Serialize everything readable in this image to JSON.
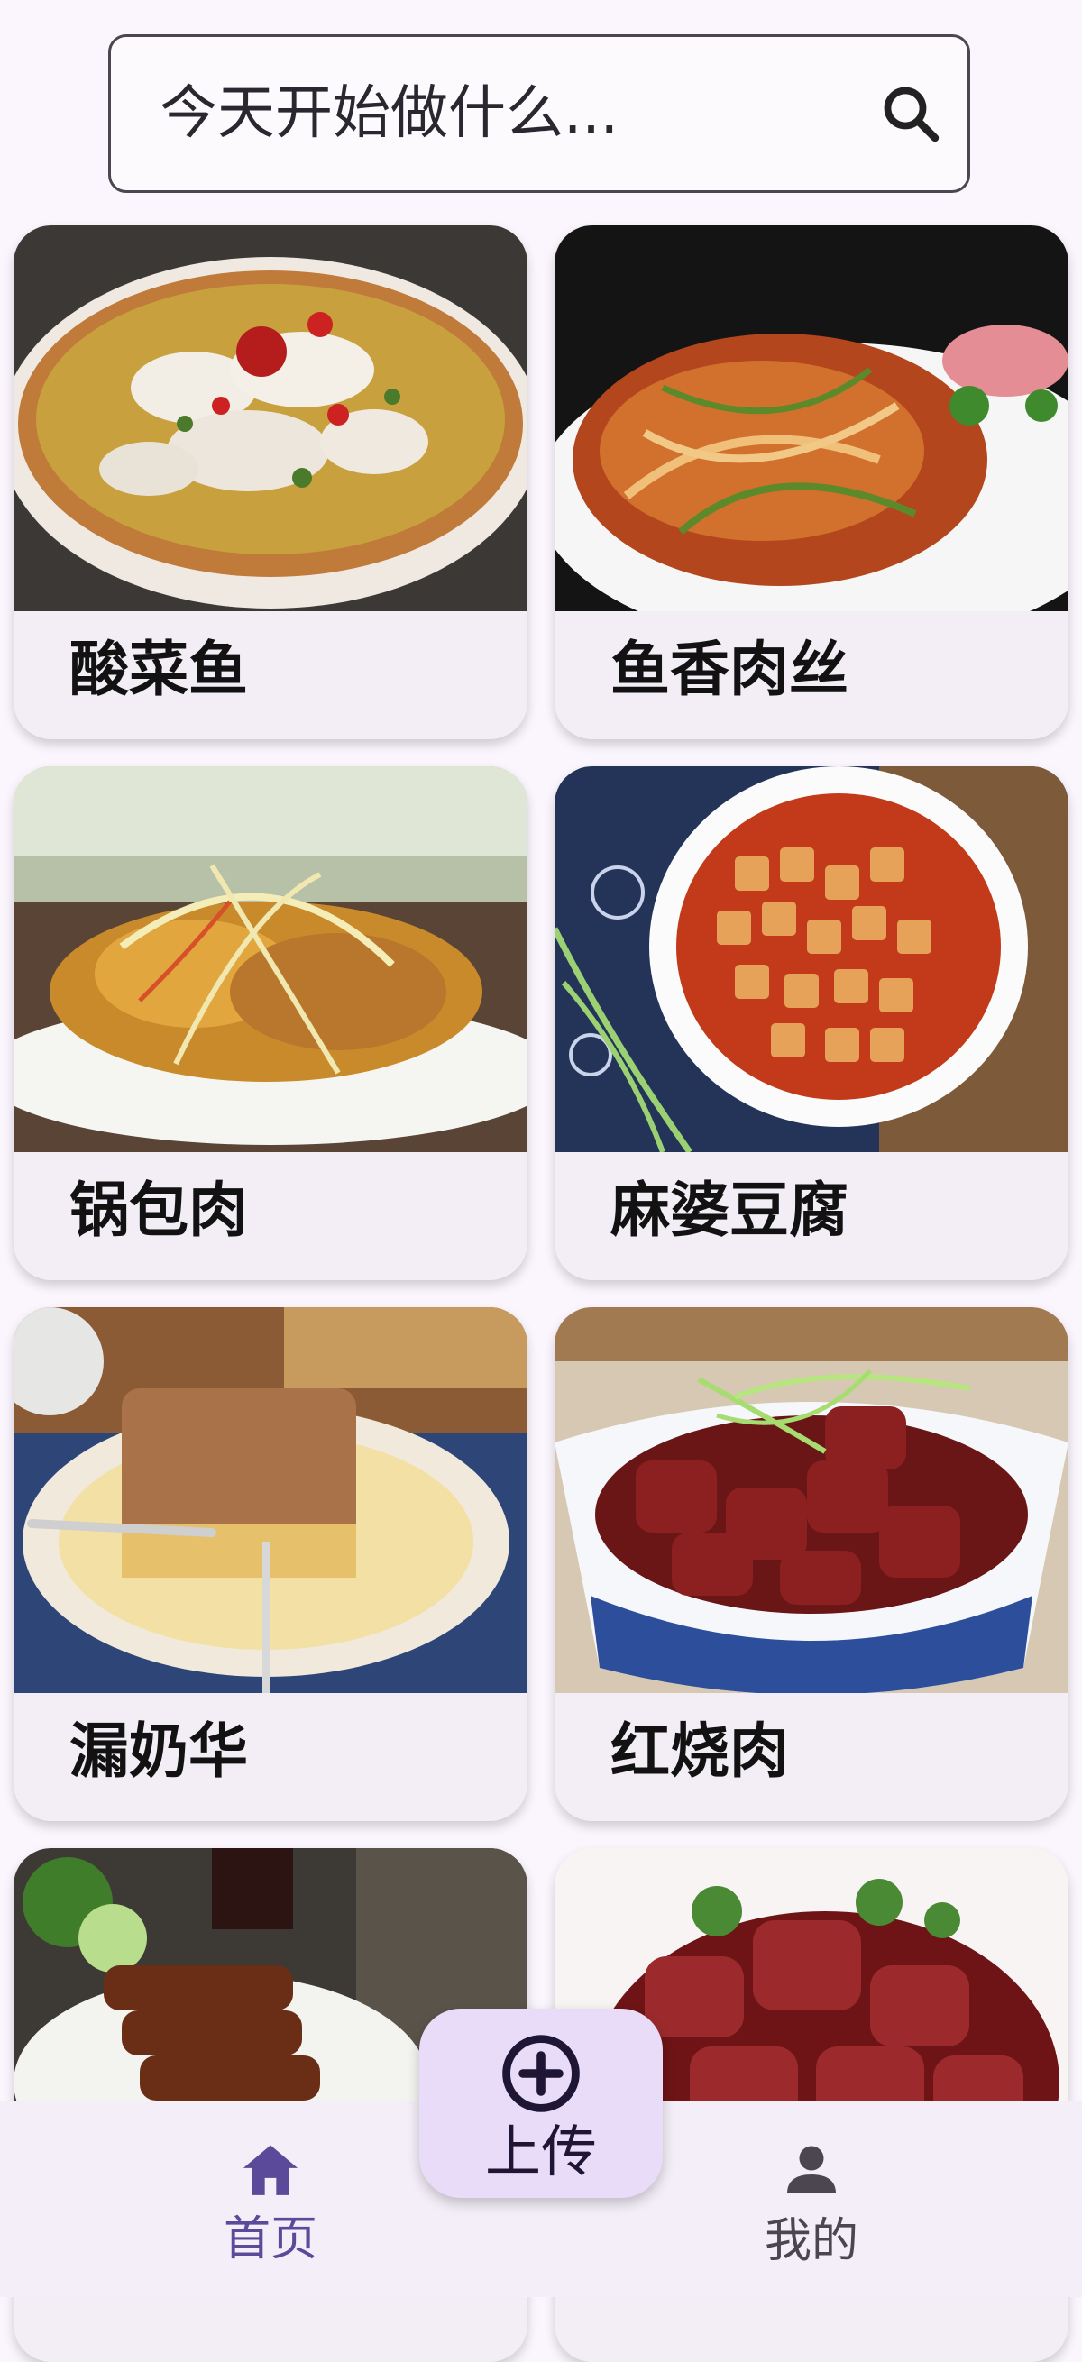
{
  "search": {
    "placeholder": "今天开始做什么..."
  },
  "dishes": [
    {
      "name": "酸菜鱼",
      "icon": "dish-photo"
    },
    {
      "name": "鱼香肉丝",
      "icon": "dish-photo"
    },
    {
      "name": "锅包肉",
      "icon": "dish-photo"
    },
    {
      "name": "麻婆豆腐",
      "icon": "dish-photo"
    },
    {
      "name": "漏奶华",
      "icon": "dish-photo"
    },
    {
      "name": "红烧肉",
      "icon": "dish-photo"
    },
    {
      "name": "",
      "icon": "dish-photo"
    },
    {
      "name": "",
      "icon": "dish-photo"
    }
  ],
  "fab": {
    "label": "上传",
    "icon": "add-circle-icon"
  },
  "nav": {
    "home_label": "首页",
    "home_icon": "home-icon",
    "mine_label": "我的",
    "mine_icon": "person-icon"
  },
  "colors": {
    "background": "#fbf6fd",
    "accent": "#5b4a9a",
    "fab": "#e8dcf8",
    "nav_bar": "#f4eef8",
    "card": "#f3eef6"
  }
}
